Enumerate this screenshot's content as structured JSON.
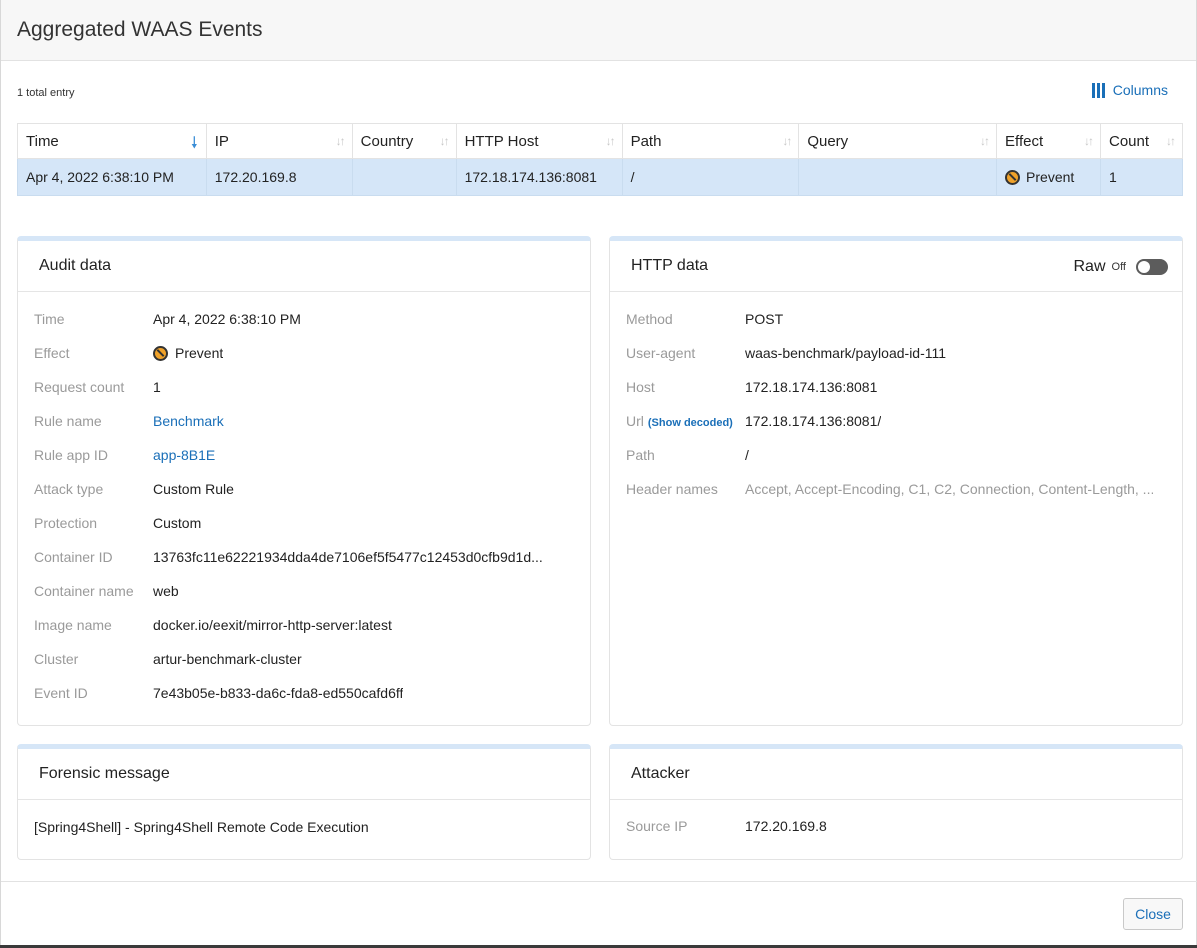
{
  "title": "Aggregated WAAS Events",
  "toolbar": {
    "total": "1 total entry",
    "columns_label": "Columns"
  },
  "table": {
    "headers": [
      "Time",
      "IP",
      "Country",
      "HTTP Host",
      "Path",
      "Query",
      "Effect",
      "Count"
    ],
    "sorted_column": "Time",
    "rows": [
      {
        "time": "Apr 4, 2022 6:38:10 PM",
        "ip": "172.20.169.8",
        "country": "",
        "http_host": "172.18.174.136:8081",
        "path": "/",
        "query": "",
        "effect": "Prevent",
        "count": "1"
      }
    ]
  },
  "audit": {
    "title": "Audit data",
    "rows": [
      {
        "label": "Time",
        "value": "Apr 4, 2022 6:38:10 PM"
      },
      {
        "label": "Effect",
        "value": "Prevent"
      },
      {
        "label": "Request count",
        "value": "1"
      },
      {
        "label": "Rule name",
        "value": "Benchmark"
      },
      {
        "label": "Rule app ID",
        "value": "app-8B1E"
      },
      {
        "label": "Attack type",
        "value": "Custom Rule"
      },
      {
        "label": "Protection",
        "value": "Custom"
      },
      {
        "label": "Container ID",
        "value": "13763fc11e62221934dda4de7106ef5f5477c12453d0cfb9d1d..."
      },
      {
        "label": "Container name",
        "value": "web"
      },
      {
        "label": "Image name",
        "value": "docker.io/eexit/mirror-http-server:latest"
      },
      {
        "label": "Cluster",
        "value": "artur-benchmark-cluster"
      },
      {
        "label": "Event ID",
        "value": "7e43b05e-b833-da6c-fda8-ed550cafd6ff"
      }
    ]
  },
  "http": {
    "title": "HTTP data",
    "raw_label": "Raw",
    "raw_state": "Off",
    "show_decoded": "(Show decoded)",
    "rows": [
      {
        "label": "Method",
        "value": "POST"
      },
      {
        "label": "User-agent",
        "value": "waas-benchmark/payload-id-111"
      },
      {
        "label": "Host",
        "value": "172.18.174.136:8081"
      },
      {
        "label": "Url",
        "value": "172.18.174.136:8081/"
      },
      {
        "label": "Path",
        "value": "/"
      },
      {
        "label": "Header names",
        "value": "Accept, Accept-Encoding, C1, C2, Connection, Content-Length, ..."
      }
    ]
  },
  "forensic": {
    "title": "Forensic message",
    "text": "[Spring4Shell] - Spring4Shell Remote Code Execution"
  },
  "attacker": {
    "title": "Attacker",
    "rows": [
      {
        "label": "Source IP",
        "value": "172.20.169.8"
      }
    ]
  },
  "footer": {
    "close_label": "Close"
  }
}
